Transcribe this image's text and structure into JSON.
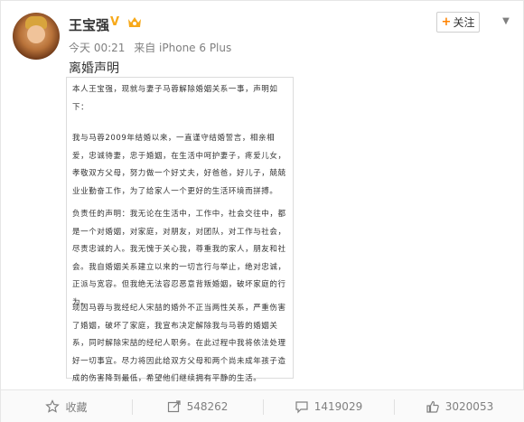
{
  "user": {
    "name": "王宝强",
    "verified_badge": "V",
    "time": "今天 00:21",
    "source": "来自 iPhone 6 Plus"
  },
  "follow_button": {
    "label": "关注"
  },
  "post": {
    "text": "离婚声明",
    "statement_paragraphs": [
      "本人王宝强，现就与妻子马蓉解除婚姻关系一事，声明如下：",
      "我与马蓉2009年结婚以来，一直谨守结婚誓言，相亲相爱，忠诚待妻，忠于婚姻，在生活中呵护妻子，疼爱儿女，孝敬双方父母，努力做一个好丈夫，好爸爸，好儿子，兢兢业业勤奋工作，为了给家人一个更好的生活环境而拼搏。",
      "负责任的声明：我无论在生活中，工作中，社会交往中，都是一个对婚姻，对家庭，对朋友，对团队，对工作与社会，尽责忠诚的人。我无愧于关心我，尊重我的家人，朋友和社会。我自婚姻关系建立以来的一切言行与举止，绝对忠诚，正派与宽容。但我绝无法容忍恶意背叛婚姻，破坏家庭的行为。",
      "现因马蓉与我经纪人宋喆的婚外不正当两性关系，严重伤害了婚姻，破坏了家庭，我宣布决定解除我与马蓉的婚姻关系，同时解除宋喆的经纪人职务。在此过程中我将依法处理好一切事宜。尽力将因此给双方父母和两个尚未成年孩子造成的伤害降到最低，希望他们继续拥有平静的生活。"
    ]
  },
  "actions": [
    {
      "label": "收藏",
      "icon": "star-icon"
    },
    {
      "label": "548262",
      "icon": "share-icon"
    },
    {
      "label": "1419029",
      "icon": "comment-icon"
    },
    {
      "label": "3020053",
      "icon": "like-icon"
    }
  ],
  "colors": {
    "verified": "#f7a91a",
    "accent": "#ff8200",
    "muted": "#808080"
  }
}
